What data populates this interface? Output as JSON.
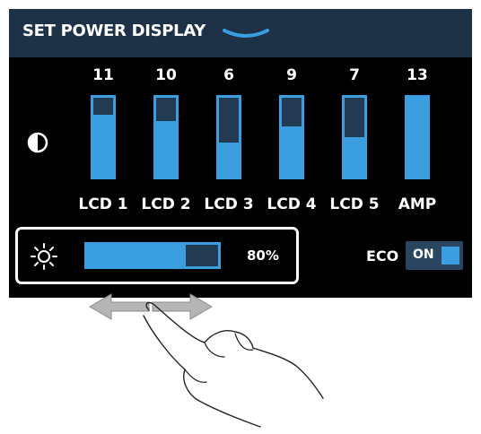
{
  "header": {
    "title": "SET POWER DISPLAY",
    "icon": "chevron-down-icon"
  },
  "contrast": {
    "icon": "contrast-icon",
    "displays": [
      {
        "name": "LCD 1",
        "value": "11",
        "fill": 0.78
      },
      {
        "name": "LCD 2",
        "value": "10",
        "fill": 0.71
      },
      {
        "name": "LCD 3",
        "value": "6",
        "fill": 0.43
      },
      {
        "name": "LCD 4",
        "value": "9",
        "fill": 0.64
      },
      {
        "name": "LCD 5",
        "value": "7",
        "fill": 0.5
      },
      {
        "name": "AMP",
        "value": "13",
        "fill": 1.0
      }
    ]
  },
  "brightness": {
    "icon": "sun-icon",
    "value": "80%",
    "fill": 0.75
  },
  "eco": {
    "label": "ECO",
    "state": "ON"
  },
  "gesture": {
    "icon": "swipe-hand-icon"
  },
  "colors": {
    "header_bg": "#1e3247",
    "accent": "#3a9ee0",
    "bar_track": "#223a52",
    "screen_bg": "#000000"
  }
}
